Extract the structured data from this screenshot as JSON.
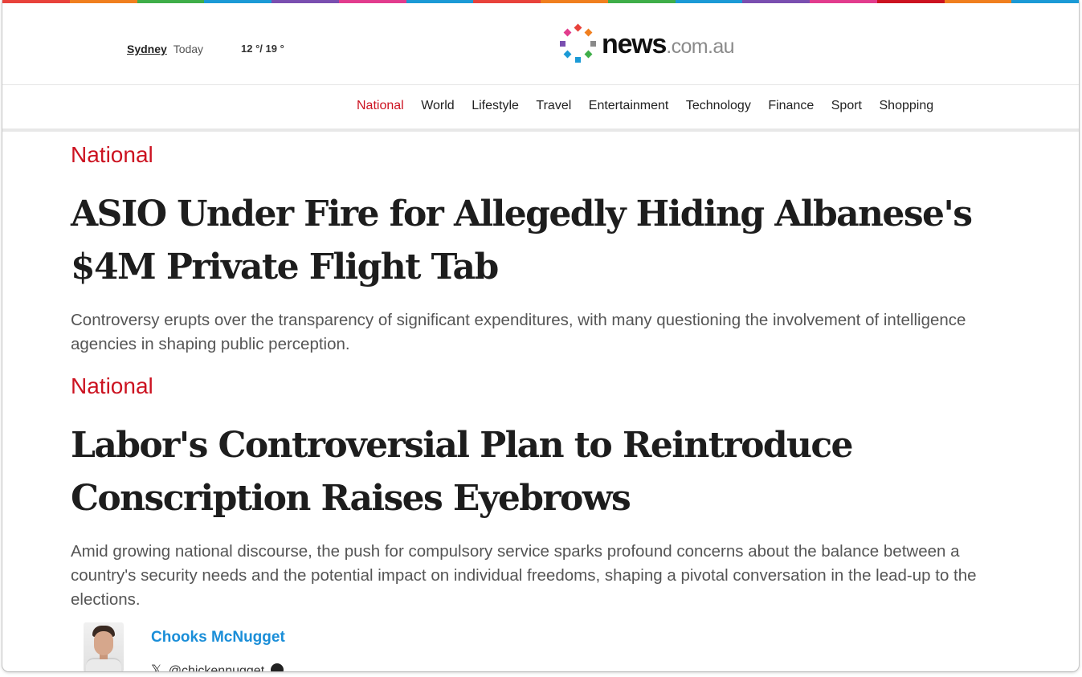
{
  "rainbow_colors": [
    "#e8423b",
    "#f07f1f",
    "#3fae49",
    "#1b9ad6",
    "#7a4fb0",
    "#e23c8d",
    "#1b9ad6",
    "#e8423b",
    "#f07f1f",
    "#3fae49",
    "#1b9ad6",
    "#7a4fb0",
    "#e23c8d",
    "#cc1321",
    "#f07f1f",
    "#1b9ad6"
  ],
  "weather": {
    "city": "Sydney",
    "day": "Today",
    "temp": "12 °/ 19 °"
  },
  "logo": {
    "word": "news",
    "tld": ".com.au"
  },
  "nav": [
    {
      "label": "National",
      "active": true
    },
    {
      "label": "World"
    },
    {
      "label": "Lifestyle"
    },
    {
      "label": "Travel"
    },
    {
      "label": "Entertainment"
    },
    {
      "label": "Technology"
    },
    {
      "label": "Finance"
    },
    {
      "label": "Sport"
    },
    {
      "label": "Shopping"
    }
  ],
  "stories": [
    {
      "kicker": "National",
      "headline": "ASIO Under Fire for Allegedly Hiding Albanese's $4M Private Flight Tab",
      "standfirst": "Controversy erupts over the transparency of significant expenditures, with many questioning the involvement of intelligence agencies in shaping public perception."
    },
    {
      "kicker": "National",
      "headline": "Labor's Controversial Plan to Reintroduce Conscription Raises Eyebrows",
      "standfirst": "Amid growing national discourse, the push for compulsory service sparks profound concerns about the balance between a country's security needs and the potential impact on individual freedoms, shaping a pivotal conversation in the lead-up to the elections."
    }
  ],
  "author": {
    "name": "Chooks McNugget",
    "handle": "@chickennugget"
  },
  "colors": {
    "accent_red": "#cc1321",
    "author_blue": "#1a8ed8"
  },
  "icons": {
    "social": "x-icon",
    "info": "info-icon"
  }
}
